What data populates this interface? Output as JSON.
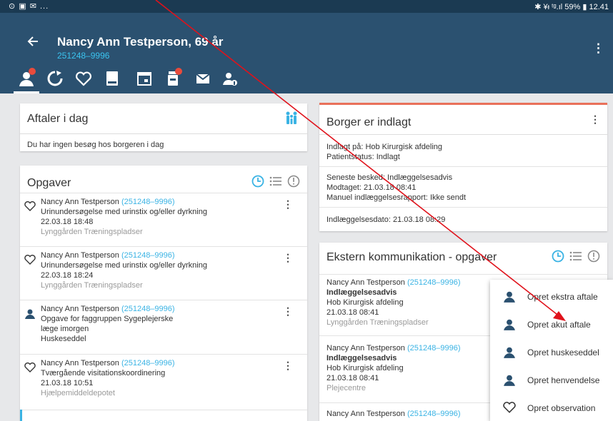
{
  "statusbar": {
    "left": "⊙ ▣ ✉ ...",
    "right": "✱ ¥ᵻ ᵗᵍ.ıl 59% ▮ 12.41"
  },
  "header": {
    "back_icon": "back-arrow-icon",
    "title": "Nancy Ann Testperson, 69 år",
    "subtitle": "251248–9996",
    "menu_icon": "more-vert-icon"
  },
  "tabs": [
    {
      "icon": "person-icon",
      "badge": true,
      "active": true
    },
    {
      "icon": "cycle-icon"
    },
    {
      "icon": "heart-icon"
    },
    {
      "icon": "book-icon"
    },
    {
      "icon": "calendar-icon"
    },
    {
      "icon": "medicine-icon",
      "badge": true
    },
    {
      "icon": "mail-icon"
    },
    {
      "icon": "person-info-icon"
    }
  ],
  "aftaler": {
    "title": "Aftaler i dag",
    "empty_text": "Du har ingen besøg hos borgeren i dag"
  },
  "opgaver": {
    "title": "Opgaver",
    "items": [
      {
        "icon": "heart-outline-icon",
        "name": "Nancy Ann Testperson",
        "cpr": "(251248–9996)",
        "line2": "Urinundersøgelse med urinstix og/eller dyrkning",
        "line3": "22.03.18 18:48",
        "line4": "Lynggården Træningspladser"
      },
      {
        "icon": "heart-outline-icon",
        "name": "Nancy Ann Testperson",
        "cpr": "(251248–9996)",
        "line2": "Urinundersøgelse med urinstix og/eller dyrkning",
        "line3": "22.03.18 18:24",
        "line4": "Lynggården Træningspladser"
      },
      {
        "icon": "person-icon",
        "name": "Nancy Ann Testperson",
        "cpr": "(251248–9996)",
        "line2": "Opgave for faggruppen Sygeplejerske",
        "line3": "læge imorgen",
        "line4": "Huskeseddel"
      },
      {
        "icon": "heart-outline-icon",
        "name": "Nancy Ann Testperson",
        "cpr": "(251248–9996)",
        "line2": "Tværgående visitationskoordinering",
        "line3": "21.03.18 10:51",
        "line4": "Hjælpemiddeldepotet"
      }
    ]
  },
  "borger": {
    "title": "Borger er indlagt",
    "indlagt_label": "Indlagt på:",
    "indlagt_value": "Hob Kirurgisk afdeling",
    "status_label": "Patientstatus:",
    "status_value": "Indlagt",
    "besked_label": "Seneste besked:",
    "besked_value": "Indlæggelsesadvis",
    "modtaget_label": "Modtaget:",
    "modtaget_value": "21.03.18 08:41",
    "manuel_label": "Manuel indlæggelsesrapport:",
    "manuel_value": "Ikke sendt",
    "dato_label": "Indlæggelsesdato:",
    "dato_value": "21.03.18 08:29"
  },
  "ekstern": {
    "title": "Ekstern kommunikation - opgaver",
    "items": [
      {
        "name": "Nancy Ann Testperson",
        "cpr": "(251248–9996)",
        "type": "Indlæggelsesadvis",
        "dept": "Hob Kirurgisk afdeling",
        "date": "21.03.18 08:41",
        "place": "Lynggården Træningspladser"
      },
      {
        "name": "Nancy Ann Testperson",
        "cpr": "(251248–9996)",
        "type": "Indlæggelsesadvis",
        "dept": "Hob Kirurgisk afdeling",
        "date": "21.03.18 08:41",
        "place": "Plejecentre"
      },
      {
        "name": "Nancy Ann Testperson",
        "cpr": "(251248–9996)"
      }
    ]
  },
  "menu": {
    "items": [
      {
        "icon": "person-icon",
        "label": "Opret ekstra aftale"
      },
      {
        "icon": "person-icon",
        "label": "Opret akut aftale"
      },
      {
        "icon": "person-icon",
        "label": "Opret huskeseddel"
      },
      {
        "icon": "person-icon",
        "label": "Opret henvendelse"
      },
      {
        "icon": "heart-outline-icon",
        "label": "Opret observation"
      }
    ]
  },
  "colors": {
    "header": "#2b5170",
    "status": "#1b3a52",
    "accent": "#3ab3e4",
    "arrow": "#e0121b",
    "alert": "#e9705a"
  }
}
